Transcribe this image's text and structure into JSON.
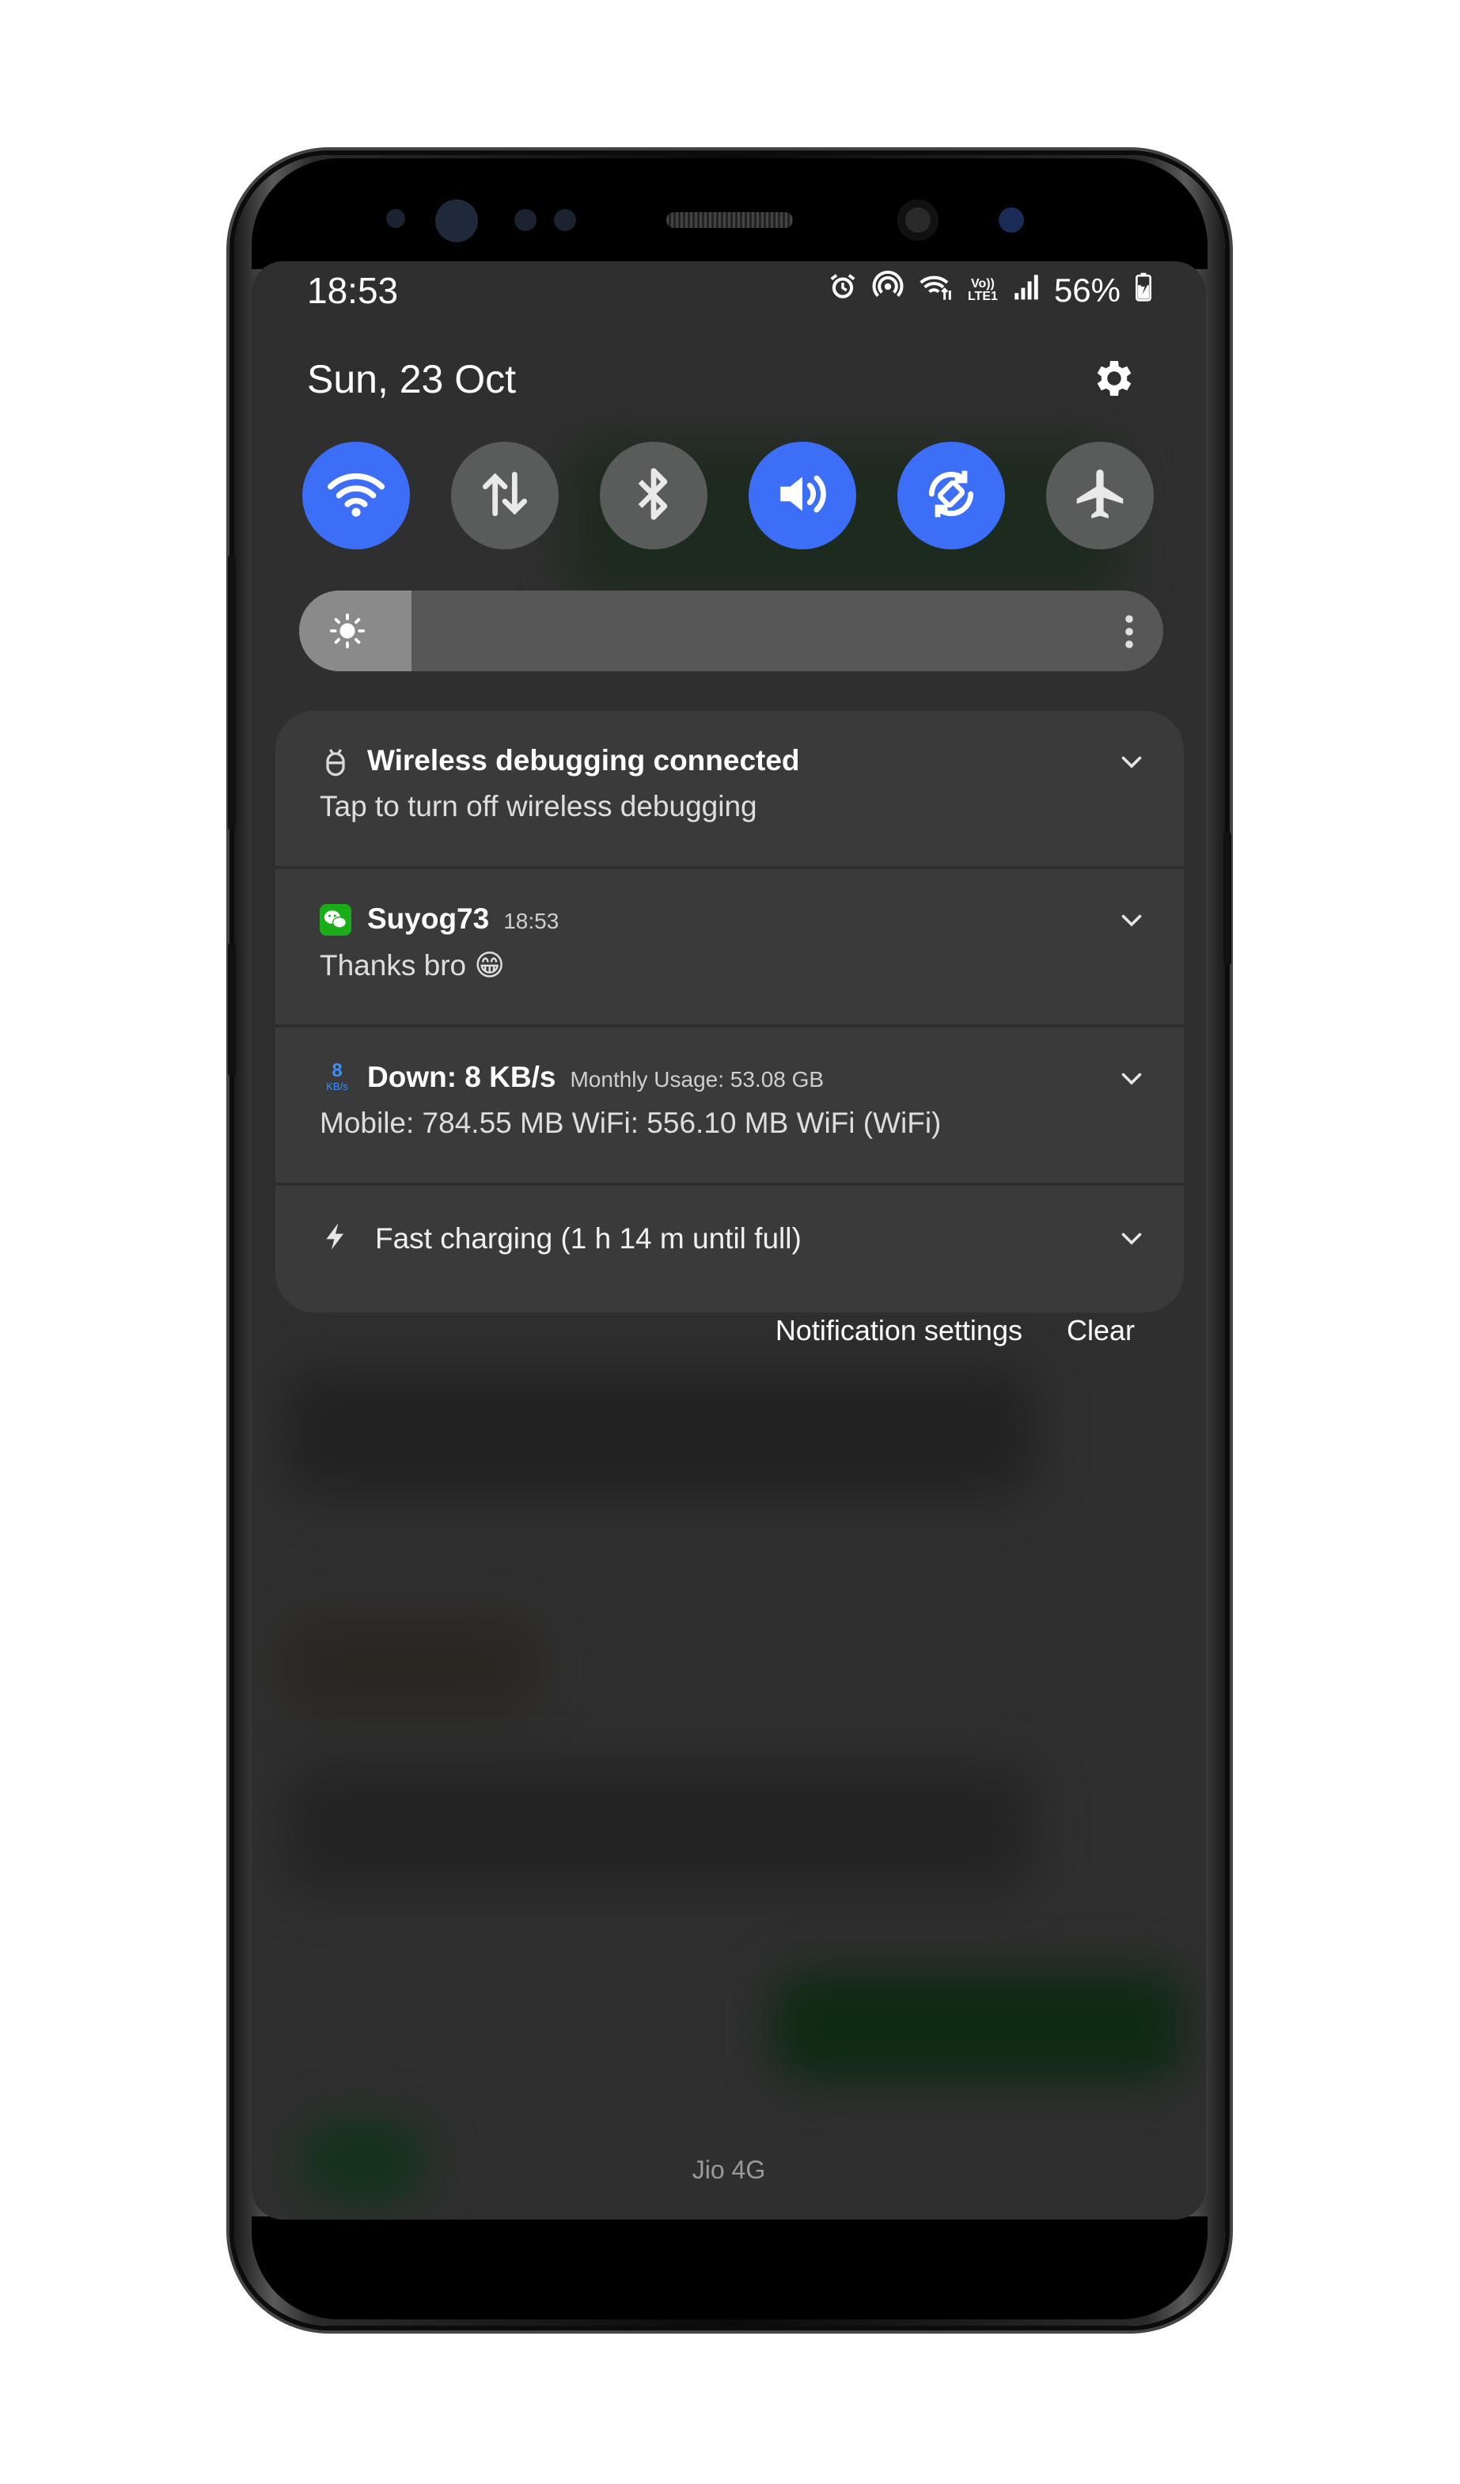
{
  "status_bar": {
    "time": "18:53",
    "lte_label": "Vo)) LTE1",
    "battery": "56%"
  },
  "header": {
    "date": "Sun, 23 Oct"
  },
  "quick_toggles": [
    {
      "name": "wifi",
      "state": "on",
      "icon": "wifi-icon"
    },
    {
      "name": "mobile-data",
      "state": "off",
      "icon": "data-arrows-icon"
    },
    {
      "name": "bluetooth",
      "state": "off",
      "icon": "bluetooth-icon"
    },
    {
      "name": "sound",
      "state": "on",
      "icon": "speaker-icon"
    },
    {
      "name": "auto-rotate",
      "state": "on",
      "icon": "rotate-icon"
    },
    {
      "name": "airplane-mode",
      "state": "off",
      "icon": "airplane-icon"
    }
  ],
  "brightness": {
    "level": 0.13
  },
  "notifications": [
    {
      "app_icon": "debug-icon",
      "title": "Wireless debugging connected",
      "meta": "",
      "body": "Tap to turn off wireless debugging"
    },
    {
      "app_icon": "wechat-icon",
      "title": "Suyog73",
      "meta": "18:53",
      "body": "Thanks bro 😁"
    },
    {
      "app_icon": "netspeed-icon",
      "icon_value": "8",
      "icon_unit": "KB/s",
      "title": "Down: 8 KB/s",
      "meta": "Monthly Usage: 53.08 GB",
      "body": "Mobile: 784.55 MB  WiFi: 556.10 MB  WiFi (WiFi)"
    },
    {
      "app_icon": "lightning-icon",
      "title": "Fast charging (1 h 14 m until full)",
      "meta": "",
      "body": ""
    }
  ],
  "actions": {
    "settings_label": "Notification settings",
    "clear_label": "Clear"
  },
  "carrier": "Jio 4G",
  "colors": {
    "accent": "#3d6ef7",
    "panel": "#3a3a3a",
    "background": "#2f2f2f"
  }
}
